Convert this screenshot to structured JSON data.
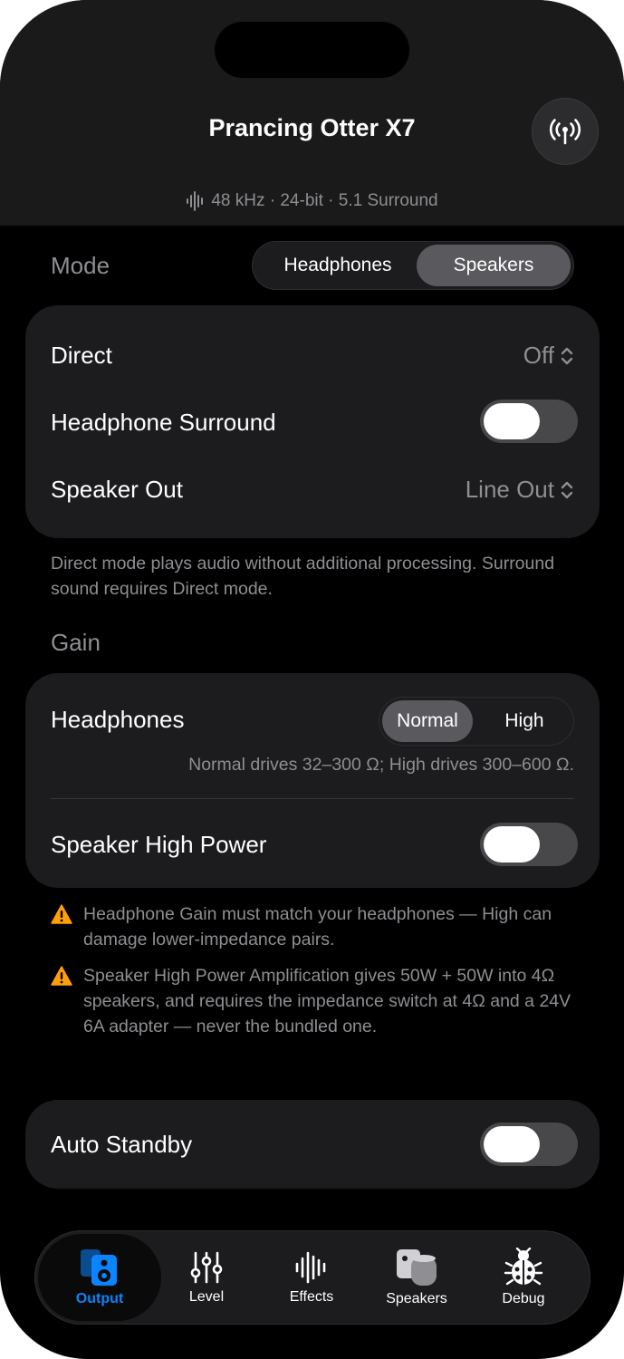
{
  "header": {
    "title": "Prancing Otter X7",
    "format": "48 kHz · 24-bit · 5.1 Surround"
  },
  "mode": {
    "label": "Mode",
    "options": [
      "Headphones",
      "Speakers"
    ],
    "selected": "Speakers"
  },
  "output_card": {
    "direct_label": "Direct",
    "direct_value": "Off",
    "surround_label": "Headphone Surround",
    "speaker_out_label": "Speaker Out",
    "speaker_out_value": "Line Out"
  },
  "output_note": "Direct mode plays audio without additional processing. Surround sound requires Direct mode.",
  "gain": {
    "label": "Gain",
    "headphones_label": "Headphones",
    "options": [
      "Normal",
      "High"
    ],
    "selected": "Normal",
    "hint": "Normal drives 32–300 Ω; High drives 300–600 Ω.",
    "speaker_high_power_label": "Speaker High Power"
  },
  "warnings": [
    "Headphone Gain must match your headphones — High can damage lower-impedance pairs.",
    "Speaker High Power Amplification gives 50W + 50W into 4Ω speakers, and requires the impedance switch at 4Ω and a 24V 6A adapter — never the bundled one."
  ],
  "standby": {
    "label": "Auto Standby"
  },
  "tabs": [
    {
      "label": "Output",
      "icon": "speaker-box-icon"
    },
    {
      "label": "Level",
      "icon": "sliders-icon"
    },
    {
      "label": "Effects",
      "icon": "waveform-icon"
    },
    {
      "label": "Speakers",
      "icon": "homepod-icon"
    },
    {
      "label": "Debug",
      "icon": "ladybug-icon"
    }
  ],
  "colors": {
    "accent": "#0a84ff",
    "warning": "#ff9f0a",
    "background": "#000000",
    "card": "#1c1c1e"
  }
}
